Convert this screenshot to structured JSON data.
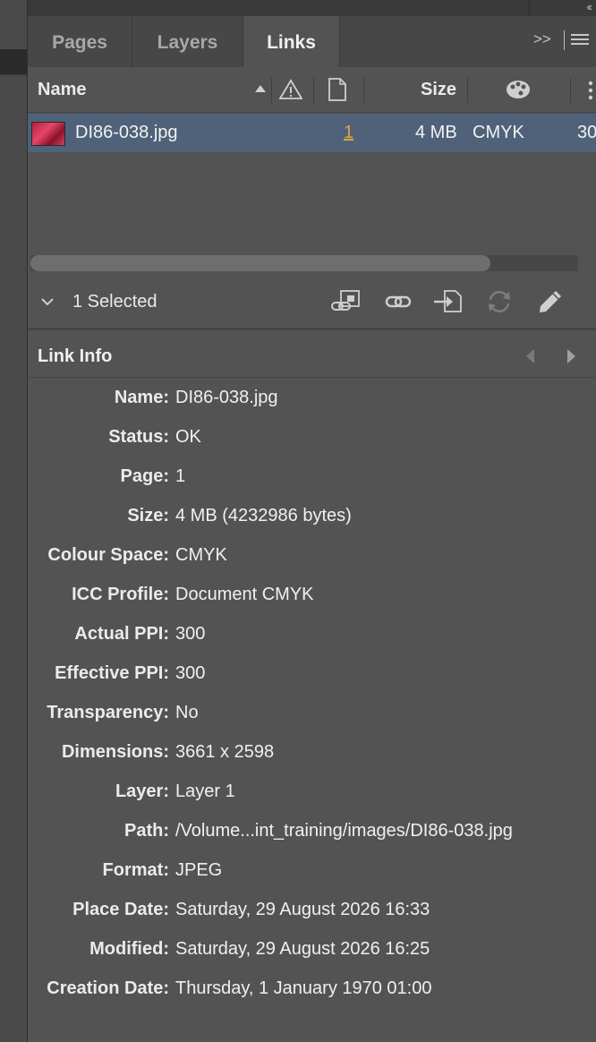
{
  "tabs": [
    {
      "label": "Pages"
    },
    {
      "label": "Layers"
    },
    {
      "label": "Links"
    }
  ],
  "columns": {
    "name": "Name",
    "size": "Size"
  },
  "link_row": {
    "filename": "DI86-038.jpg",
    "page": "1",
    "size": "4 MB",
    "colour": "CMYK",
    "ppi_partial": "30"
  },
  "selection": {
    "label": "1 Selected"
  },
  "link_info": {
    "title": "Link Info",
    "rows": [
      {
        "label": "Name:",
        "value": "DI86-038.jpg"
      },
      {
        "label": "Status:",
        "value": "OK"
      },
      {
        "label": "Page:",
        "value": "1"
      },
      {
        "label": "Size:",
        "value": "4 MB (4232986 bytes)"
      },
      {
        "label": "Colour Space:",
        "value": "CMYK"
      },
      {
        "label": "ICC Profile:",
        "value": "Document CMYK"
      },
      {
        "label": "Actual PPI:",
        "value": "300"
      },
      {
        "label": "Effective PPI:",
        "value": "300"
      },
      {
        "label": "Transparency:",
        "value": "No"
      },
      {
        "label": "Dimensions:",
        "value": "3661 x 2598"
      },
      {
        "label": "Layer:",
        "value": "Layer 1"
      },
      {
        "label": "Path:",
        "value": "/Volume...int_training/images/DI86-038.jpg"
      },
      {
        "label": "Format:",
        "value": "JPEG"
      },
      {
        "label": "Place Date:",
        "value": "Saturday, 29 August 2026 16:33"
      },
      {
        "label": "Modified:",
        "value": "Saturday, 29 August 2026 16:25"
      },
      {
        "label": "Creation Date:",
        "value": "Thursday, 1 January 1970 01:00"
      }
    ]
  },
  "colors": {
    "panel_bg": "#535353",
    "selected_row": "#4f6279",
    "page_link": "#e6a23c"
  },
  "icons": [
    "collapse-icon",
    "panel-expand-icon",
    "panel-menu-icon",
    "sort-ascending-icon",
    "warning-icon",
    "page-icon",
    "colour-space-icon",
    "more-columns-icon",
    "disclosure-chevron-icon",
    "relink-from-cc-icon",
    "relink-icon",
    "go-to-link-icon",
    "update-link-icon",
    "edit-original-icon",
    "previous-icon",
    "next-icon"
  ]
}
